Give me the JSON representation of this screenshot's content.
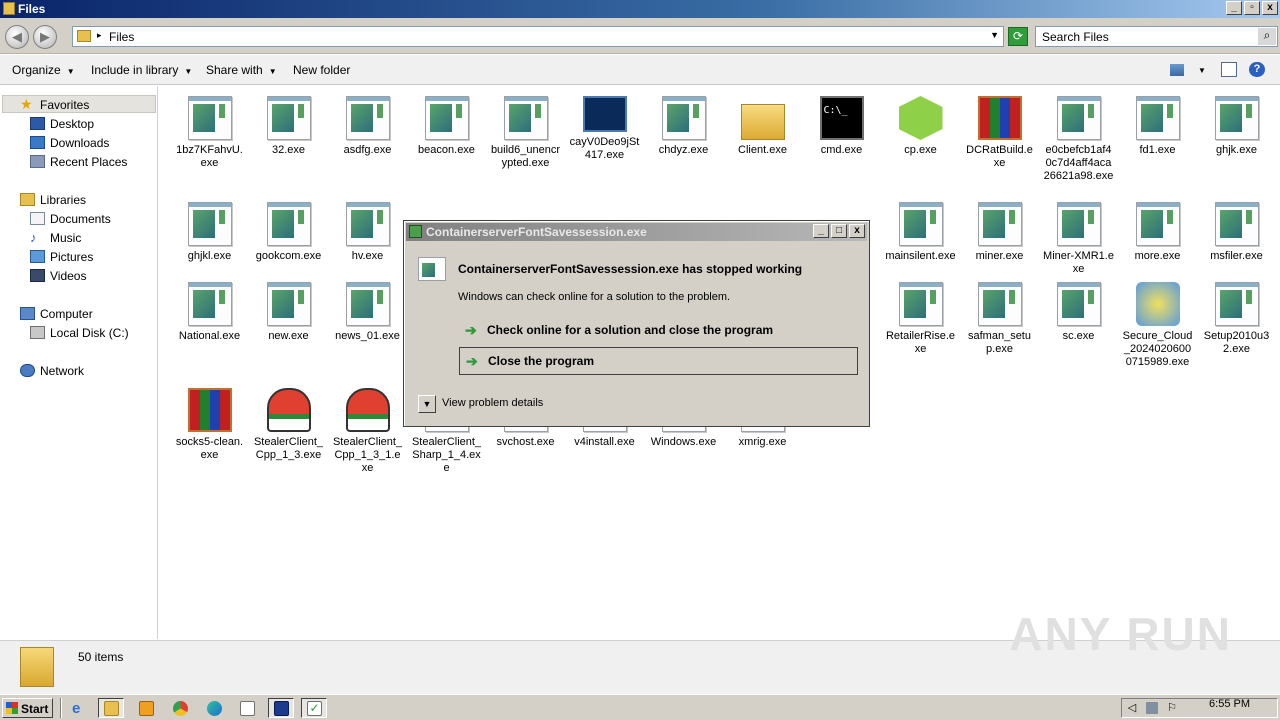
{
  "window": {
    "title": "Files",
    "address": "Files",
    "search_placeholder": "Search Files",
    "toolbar": {
      "organize": "Organize",
      "include_in_library": "Include in library",
      "share_with": "Share with",
      "new_folder": "New folder"
    },
    "nav": {
      "favorites": "Favorites",
      "desktop": "Desktop",
      "downloads": "Downloads",
      "recent_places": "Recent Places",
      "libraries": "Libraries",
      "documents": "Documents",
      "music": "Music",
      "pictures": "Pictures",
      "videos": "Videos",
      "computer": "Computer",
      "local_disk": "Local Disk (C:)",
      "network": "Network"
    },
    "status": "50 items"
  },
  "files": [
    {
      "name": "1bz7KFahvU.exe",
      "icon": "exe"
    },
    {
      "name": "32.exe",
      "icon": "exe"
    },
    {
      "name": "asdfg.exe",
      "icon": "exe"
    },
    {
      "name": "beacon.exe",
      "icon": "exe"
    },
    {
      "name": "build6_unencrypted.exe",
      "icon": "exe"
    },
    {
      "name": "cayV0Deo9jSt417.exe",
      "icon": "network-computer"
    },
    {
      "name": "chdyz.exe",
      "icon": "exe"
    },
    {
      "name": "Client.exe",
      "icon": "folder"
    },
    {
      "name": "cmd.exe",
      "icon": "cmd"
    },
    {
      "name": "cp.exe",
      "icon": "green-cube"
    },
    {
      "name": "DCRatBuild.exe",
      "icon": "winrar"
    },
    {
      "name": "e0cbefcb1af40c7d4aff4aca26621a98.exe",
      "icon": "exe"
    },
    {
      "name": "fd1.exe",
      "icon": "exe"
    },
    {
      "name": "ghjk.exe",
      "icon": "exe"
    },
    {
      "name": "ghjkl.exe",
      "icon": "exe"
    },
    {
      "name": "gookcom.exe",
      "icon": "exe"
    },
    {
      "name": "hv.exe",
      "icon": "exe"
    },
    {
      "name": "mainsilent.exe",
      "icon": "exe"
    },
    {
      "name": "miner.exe",
      "icon": "exe"
    },
    {
      "name": "Miner-XMR1.exe",
      "icon": "exe"
    },
    {
      "name": "more.exe",
      "icon": "exe"
    },
    {
      "name": "msfiler.exe",
      "icon": "exe"
    },
    {
      "name": "National.exe",
      "icon": "exe"
    },
    {
      "name": "new.exe",
      "icon": "exe"
    },
    {
      "name": "news_01.exe",
      "icon": "exe"
    },
    {
      "name": "RetailerRise.exe",
      "icon": "exe"
    },
    {
      "name": "safman_setup.exe",
      "icon": "exe"
    },
    {
      "name": "sc.exe",
      "icon": "exe"
    },
    {
      "name": "Secure_Cloud_20240206000715989.exe",
      "icon": "installer"
    },
    {
      "name": "Setup2010u32.exe",
      "icon": "exe"
    },
    {
      "name": "socks5-clean.exe",
      "icon": "winrar"
    },
    {
      "name": "StealerClient_Cpp_1_3.exe",
      "icon": "mitten"
    },
    {
      "name": "StealerClient_Cpp_1_3_1.exe",
      "icon": "mitten"
    },
    {
      "name": "StealerClient_Sharp_1_4.exe",
      "icon": "exe"
    },
    {
      "name": "svchost.exe",
      "icon": "exe"
    },
    {
      "name": "v4install.exe",
      "icon": "exe"
    },
    {
      "name": "Windows.exe",
      "icon": "exe"
    },
    {
      "name": "xmrig.exe",
      "icon": "exe"
    }
  ],
  "dialog": {
    "title": "ContainerserverFontSavessession.exe",
    "heading": "ContainerserverFontSavessession.exe has stopped working",
    "message": "Windows can check online for a solution to the problem.",
    "option1": "Check online for a solution and close the program",
    "option2": "Close the program",
    "details": "View problem details"
  },
  "taskbar": {
    "start": "Start",
    "clock": "6:55 PM"
  },
  "watermark": "ANY RUN"
}
